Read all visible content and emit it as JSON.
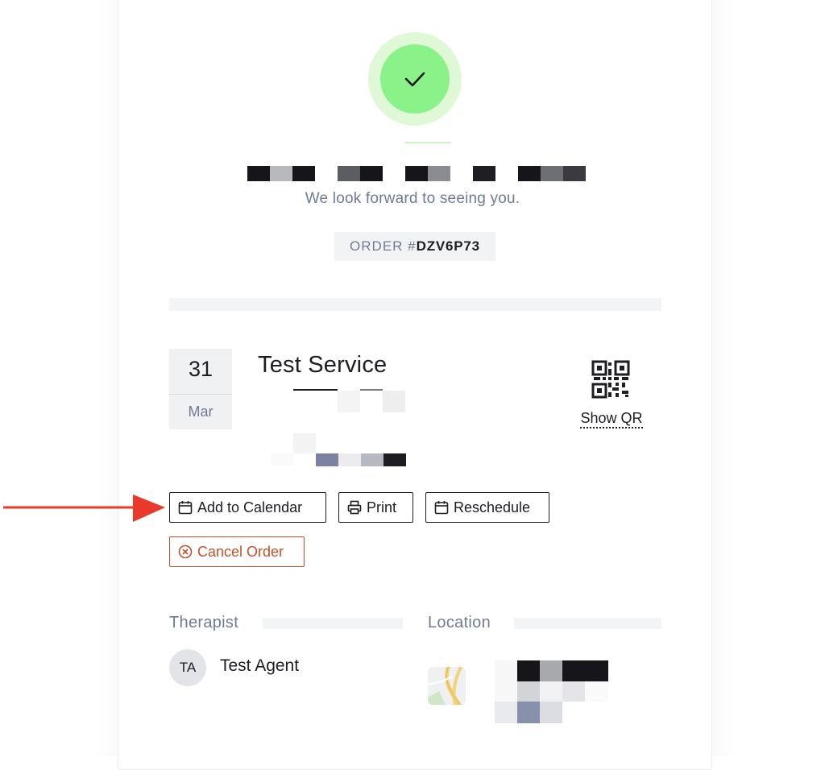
{
  "header": {
    "subtitle": "We look forward to seeing you.",
    "order_label": "ORDER #",
    "order_code": "DZV6P73"
  },
  "booking": {
    "day": "31",
    "month": "Mar",
    "service_title": "Test Service",
    "show_qr_label": "Show QR"
  },
  "actions": {
    "add_to_calendar": "Add to Calendar",
    "print": "Print",
    "reschedule": "Reschedule",
    "cancel_order": "Cancel Order"
  },
  "details": {
    "therapist_label": "Therapist",
    "therapist_initials": "TA",
    "therapist_name": "Test Agent",
    "location_label": "Location"
  },
  "colors": {
    "success": "#8bf28a",
    "muted_text": "#6f7b96",
    "danger": "#c6502a",
    "annotation_arrow": "#e8392a"
  },
  "icons": [
    "check-icon",
    "qr-code-icon",
    "calendar-icon",
    "printer-icon",
    "cancel-circle-icon",
    "map-icon"
  ]
}
